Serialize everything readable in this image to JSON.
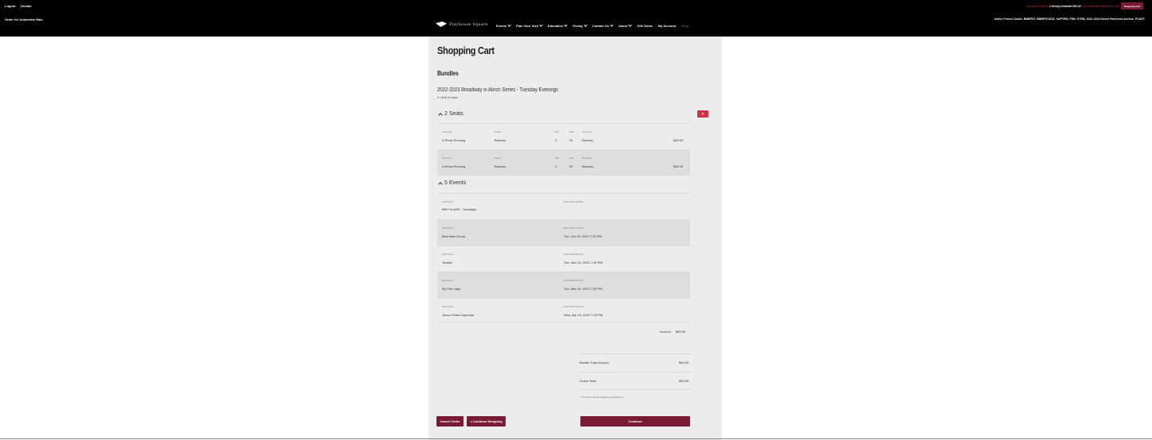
{
  "header": {
    "logout": "Logout",
    "donate": "Donate",
    "order_for": "Order for Antoinette Rals",
    "status_lead": "You have 1 offer in",
    "status_items": "2 Item(s) Subtotal $90.00",
    "status_timer": "Your order will timeout in 14:58",
    "cart_button": "Shopping Cart",
    "promo": "Active Promo Codes: BBBPST, BBBPSTADD, SUPTRN, FRN, STRN, 2022-2023 Donor Reserved Access, PCAST"
  },
  "logo": {
    "text": "Playhouse Square",
    "icon": "logo-mark"
  },
  "nav": {
    "items": [
      {
        "label": "Events",
        "dropdown": true
      },
      {
        "label": "Plan Your Visit",
        "dropdown": true
      },
      {
        "label": "Education",
        "dropdown": true
      },
      {
        "label": "Giving",
        "dropdown": true
      },
      {
        "label": "Contact Us",
        "dropdown": true
      },
      {
        "label": "About",
        "dropdown": true
      },
      {
        "label": "Gift Cards",
        "dropdown": false
      },
      {
        "label": "My Account",
        "dropdown": false
      },
      {
        "label": "Blog",
        "dropdown": false
      }
    ]
  },
  "cart": {
    "title": "Shopping Cart",
    "section": "Bundles",
    "bundle_name": "2022-2023 Broadway in Akron Series - Tuesday Evenings",
    "bundle_price": "2 x $45.00 each",
    "remove_icon": "close-icon",
    "seats_head": "2 Seats",
    "seat_labels": {
      "price_type": "Price Type",
      "section": "Section",
      "row": "Row",
      "seat": "Seat",
      "price_zone": "Price Zone"
    },
    "seats": [
      {
        "price_type": "A Show Evening",
        "section": "Balcony",
        "row": "C",
        "seat": "24",
        "price_zone": "Balcony",
        "price": "$45.00"
      },
      {
        "price_type": "A Show Evening",
        "section": "Balcony",
        "row": "C",
        "seat": "25",
        "price_zone": "Balcony",
        "price": "$45.00"
      }
    ],
    "events_head": "5 Events",
    "event_labels": {
      "name": "Event Name",
      "date": "Event Start Date/Time"
    },
    "events": [
      {
        "name": "BWY in AKR - Tuesdays",
        "date": ""
      },
      {
        "name": "Blue Man Group",
        "date": "Tue, Oct 18, 2022 7:30 PM"
      },
      {
        "name": "Tootsie",
        "date": "Tue, Nov 29, 2022 7:30 PM"
      },
      {
        "name": "My Fair Lady",
        "date": "Tue, Mar 14, 2023 7:30 PM"
      },
      {
        "name": "Jesus Christ Superstar",
        "date": "Wed, Apr 19, 2023 7:30 PM"
      }
    ],
    "amount_label": "Amount",
    "amount": "$90.00",
    "bundle_total_label": "Bundle Total Amount",
    "bundle_total": "$90.00",
    "grand_total_label": "Grand Total",
    "grand_total": "$90.00",
    "tax_note": "Your order may be subject to a delivery fee.",
    "cancel": "Cancel Order",
    "continue_shopping": "< Continue Shopping",
    "continue": "Continue"
  }
}
